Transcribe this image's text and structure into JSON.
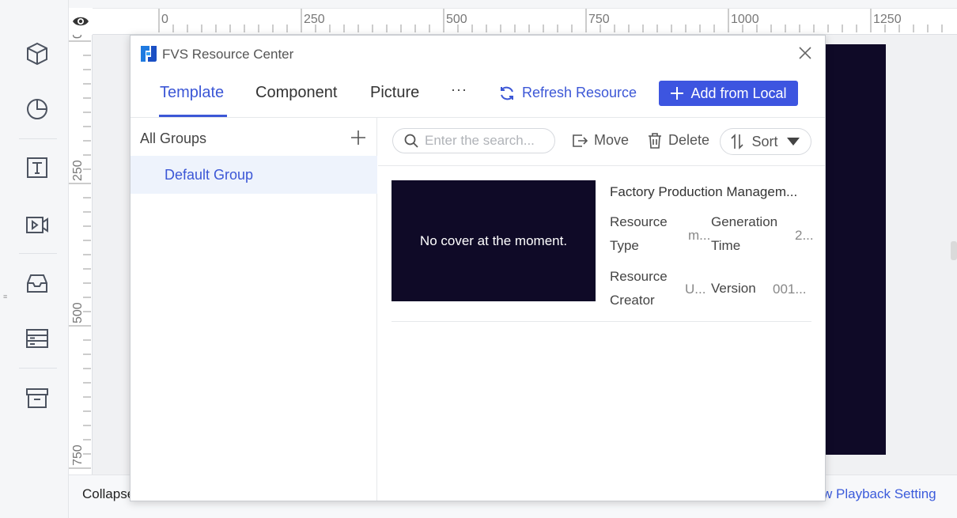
{
  "ruler": {
    "top_ticks": [
      "0",
      "250",
      "500",
      "750",
      "1000",
      "1250"
    ],
    "left_ticks": [
      "0",
      "250",
      "500",
      "750"
    ]
  },
  "sidebar": {
    "icons": [
      "cube-icon",
      "pie-chart-icon",
      "text-box-icon",
      "video-icon",
      "inbox-icon",
      "server-list-icon",
      "archive-icon"
    ]
  },
  "bottom": {
    "left_text": "Collapse",
    "right_text": "w Playback Setting"
  },
  "dialog": {
    "title": "FVS Resource Center",
    "tabs": [
      {
        "label": "Template",
        "active": true
      },
      {
        "label": "Component",
        "active": false
      },
      {
        "label": "Picture",
        "active": false
      }
    ],
    "more_label": "···",
    "refresh_label": "Refresh Resource",
    "add_local_label": "Add from Local",
    "groups": {
      "header": "All Groups",
      "items": [
        "Default Group"
      ]
    },
    "toolbar": {
      "search_placeholder": "Enter the search...",
      "move_label": "Move",
      "delete_label": "Delete",
      "sort_label": "Sort"
    },
    "resource": {
      "cover_text": "No cover at the moment.",
      "name": "Factory Production Managem...",
      "type_label_1": "Resource",
      "type_label_2": "Type",
      "type_value": "m...",
      "gen_label_1": "Generation",
      "gen_label_2": "Time",
      "gen_value": "2...",
      "creator_label_1": "Resource",
      "creator_label_2": "Creator",
      "creator_value": "U...",
      "version_label": "Version",
      "version_value": "001..."
    }
  },
  "colors": {
    "accent": "#3c57d6",
    "button_bg": "#3d55e0",
    "canvas_dark": "#0f0a27"
  }
}
